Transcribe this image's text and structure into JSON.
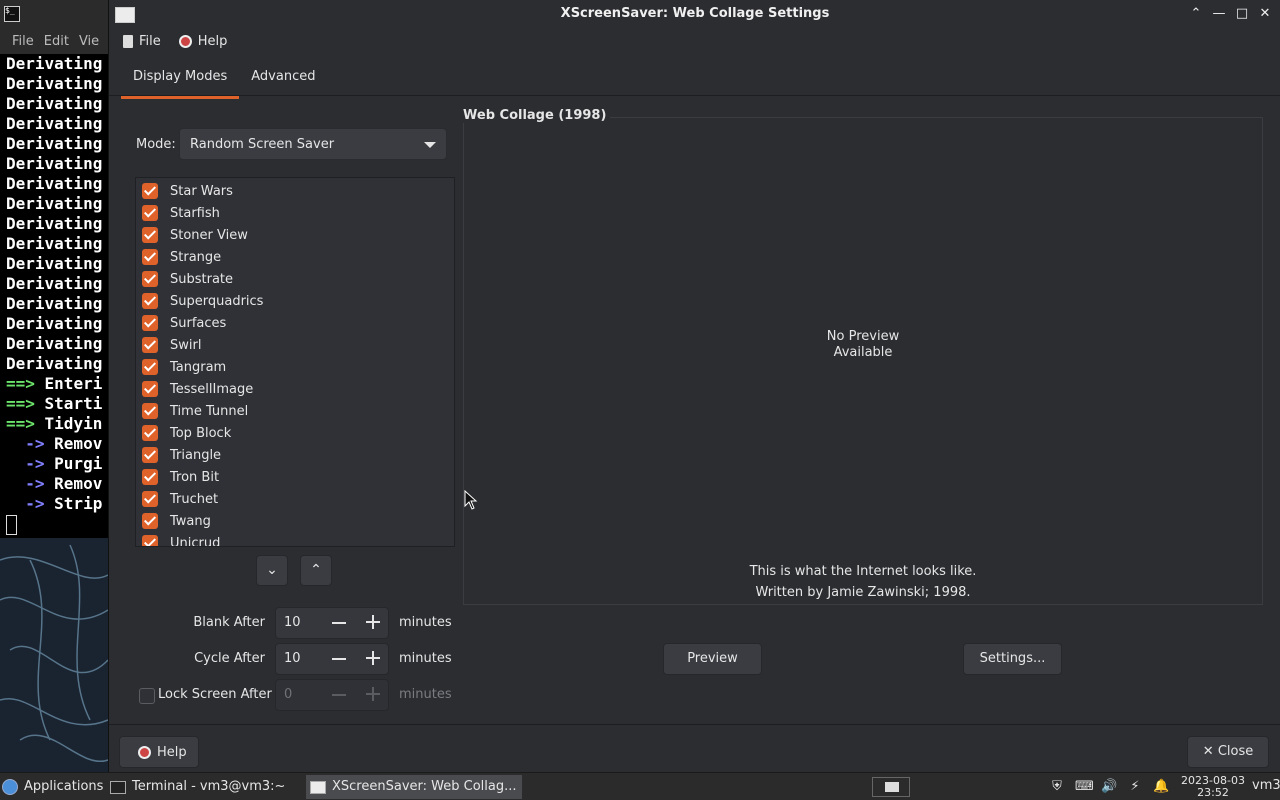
{
  "terminal": {
    "menu": [
      "File",
      "Edit",
      "Vie"
    ],
    "lines": [
      {
        "kind": "plain",
        "text": "Derivating"
      },
      {
        "kind": "plain",
        "text": "Derivating"
      },
      {
        "kind": "plain",
        "text": "Derivating"
      },
      {
        "kind": "plain",
        "text": "Derivating"
      },
      {
        "kind": "plain",
        "text": "Derivating"
      },
      {
        "kind": "plain",
        "text": "Derivating"
      },
      {
        "kind": "plain",
        "text": "Derivating"
      },
      {
        "kind": "plain",
        "text": "Derivating"
      },
      {
        "kind": "plain",
        "text": "Derivating"
      },
      {
        "kind": "plain",
        "text": "Derivating"
      },
      {
        "kind": "plain",
        "text": "Derivating"
      },
      {
        "kind": "plain",
        "text": "Derivating"
      },
      {
        "kind": "plain",
        "text": "Derivating"
      },
      {
        "kind": "plain",
        "text": "Derivating"
      },
      {
        "kind": "plain",
        "text": "Derivating"
      },
      {
        "kind": "plain",
        "text": "Derivating"
      },
      {
        "kind": "green",
        "arrow": "==>",
        "text": " Enteri"
      },
      {
        "kind": "green",
        "arrow": "==>",
        "text": " Starti"
      },
      {
        "kind": "green",
        "arrow": "==>",
        "text": " Tidyin"
      },
      {
        "kind": "blue",
        "arrow": "  ->",
        "text": " Remov"
      },
      {
        "kind": "blue",
        "arrow": "  ->",
        "text": " Purgi"
      },
      {
        "kind": "blue",
        "arrow": "  ->",
        "text": " Remov"
      },
      {
        "kind": "blue",
        "arrow": "  ->",
        "text": " Strip"
      }
    ]
  },
  "window": {
    "title": "XScreenSaver: Web Collage Settings",
    "menu": {
      "file": "File",
      "help": "Help"
    },
    "tabs": [
      {
        "label": "Display Modes",
        "active": true
      },
      {
        "label": "Advanced",
        "active": false
      }
    ],
    "mode": {
      "label": "Mode:",
      "value": "Random Screen Saver"
    },
    "hacks": [
      "Star Wars",
      "Starfish",
      "Stoner View",
      "Strange",
      "Substrate",
      "Superquadrics",
      "Surfaces",
      "Swirl",
      "Tangram",
      "TessellImage",
      "Time Tunnel",
      "Top Block",
      "Triangle",
      "Tron Bit",
      "Truchet",
      "Twang",
      "Unicrud"
    ],
    "blank_after": {
      "label": "Blank After",
      "value": "10",
      "unit": "minutes"
    },
    "cycle_after": {
      "label": "Cycle After",
      "value": "10",
      "unit": "minutes"
    },
    "lock_after": {
      "label": "Lock Screen After",
      "value": "0",
      "unit": "minutes",
      "checked": false
    },
    "preview": {
      "title": "Web Collage (1998)",
      "no_preview_line1": "No Preview",
      "no_preview_line2": "Available",
      "description": "This is what the Internet looks like.",
      "author": "Written by Jamie Zawinski; 1998.",
      "preview_button": "Preview",
      "settings_button": "Settings..."
    },
    "help_button": "Help",
    "close_button": "Close"
  },
  "taskbar": {
    "applications": "Applications",
    "tasks": [
      {
        "label": "Terminal - vm3@vm3:~",
        "active": false
      },
      {
        "label": "XScreenSaver: Web Collag...",
        "active": true
      }
    ],
    "clock_date": "2023-08-03",
    "clock_time": "23:52",
    "user": "vm3"
  },
  "colors": {
    "accent": "#e0622b",
    "window_bg": "#2b2d31",
    "terminal_bg": "#000000"
  }
}
